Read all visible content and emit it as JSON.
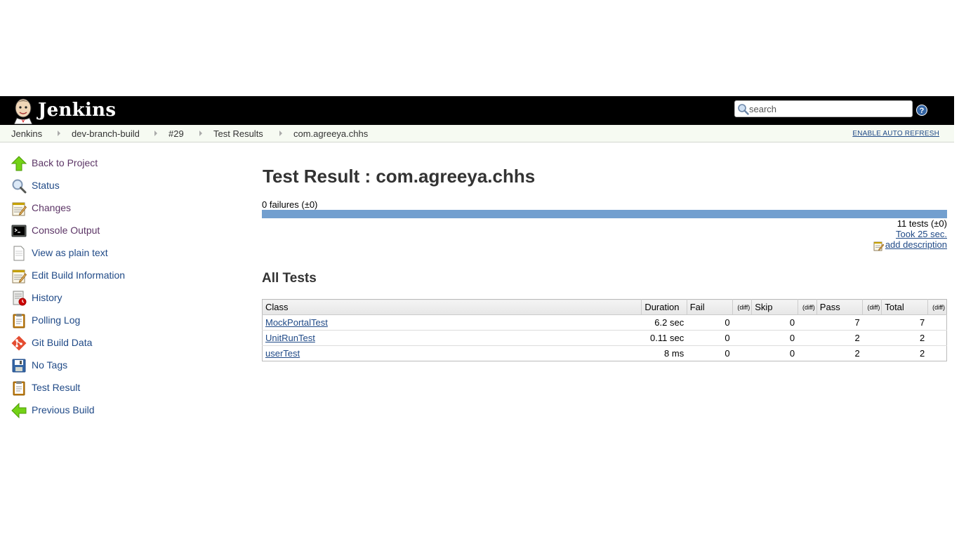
{
  "header": {
    "brand": "Jenkins",
    "search": {
      "placeholder": "search",
      "value": ""
    }
  },
  "breadcrumbs": [
    "Jenkins",
    "dev-branch-build",
    "#29",
    "Test Results",
    "com.agreeya.chhs"
  ],
  "auto_refresh_label": "ENABLE AUTO REFRESH",
  "sidebar": {
    "items": [
      {
        "label": "Back to Project",
        "icon": "up-arrow-icon"
      },
      {
        "label": "Status",
        "icon": "search-icon"
      },
      {
        "label": "Changes",
        "icon": "notepad-icon"
      },
      {
        "label": "Console Output",
        "icon": "terminal-icon"
      },
      {
        "label": "View as plain text",
        "icon": "document-icon"
      },
      {
        "label": "Edit Build Information",
        "icon": "notepad-icon"
      },
      {
        "label": "History",
        "icon": "history-icon"
      },
      {
        "label": "Polling Log",
        "icon": "clipboard-icon"
      },
      {
        "label": "Git Build Data",
        "icon": "git-icon"
      },
      {
        "label": "No Tags",
        "icon": "save-icon"
      },
      {
        "label": "Test Result",
        "icon": "clipboard-icon"
      },
      {
        "label": "Previous Build",
        "icon": "left-arrow-icon"
      }
    ]
  },
  "main": {
    "title": "Test Result : com.agreeya.chhs",
    "failures": "0 failures (±0)",
    "fail_fraction": 0,
    "tests_count": "11 tests (±0)",
    "took": "Took 25 sec.",
    "add_description": "add description",
    "section_title": "All Tests",
    "table": {
      "headers": {
        "class": "Class",
        "duration": "Duration",
        "fail": "Fail",
        "skip": "Skip",
        "pass": "Pass",
        "total": "Total",
        "diff": "(diff)"
      },
      "rows": [
        {
          "class": "MockPortalTest",
          "duration": "6.2 sec",
          "fail": "0",
          "skip": "0",
          "pass": "7",
          "total": "7"
        },
        {
          "class": "UnitRunTest",
          "duration": "0.11 sec",
          "fail": "0",
          "skip": "0",
          "pass": "2",
          "total": "2"
        },
        {
          "class": "userTest",
          "duration": "8 ms",
          "fail": "0",
          "skip": "0",
          "pass": "2",
          "total": "2"
        }
      ]
    }
  },
  "colors": {
    "pass_bar": "#729fcf",
    "fail_bar": "#ef2929",
    "link": "#204a87",
    "visited_link": "#5c3566"
  }
}
